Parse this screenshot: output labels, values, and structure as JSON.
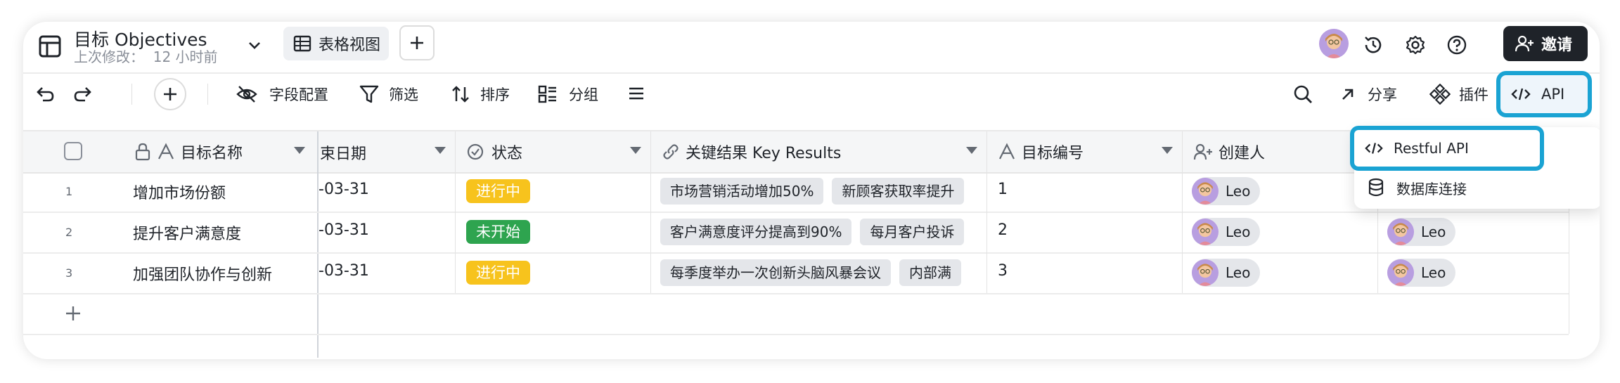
{
  "header": {
    "title": "目标 Objectives",
    "subtitle": "上次修改：  12 小时前",
    "view_label": "表格视图",
    "invite_label": "邀请"
  },
  "toolbar": {
    "field_config": "字段配置",
    "filter": "筛选",
    "sort": "排序",
    "group": "分组",
    "share": "分享",
    "plugins": "插件",
    "api": "API"
  },
  "api_menu": {
    "items": [
      {
        "label": "Restful API"
      },
      {
        "label": "数据库连接"
      }
    ]
  },
  "table": {
    "columns": {
      "name": "目标名称",
      "end_date": "束日期",
      "status": "状态",
      "key_results": "关键结果 Key Results",
      "number": "目标编号",
      "creator": "创建人"
    },
    "rows": [
      {
        "index": "1",
        "name": "增加市场份额",
        "date": "-03-31",
        "status": "进行中",
        "status_color": "#f7c31d",
        "kr1": "市场营销活动增加50%",
        "kr2": "新顾客获取率提升",
        "number": "1",
        "creator": "Leo"
      },
      {
        "index": "2",
        "name": "提升客户满意度",
        "date": "-03-31",
        "status": "未开始",
        "status_color": "#2ea44f",
        "kr1": "客户满意度评分提高到90%",
        "kr2": "每月客户投诉",
        "number": "2",
        "creator": "Leo",
        "extra": "Leo"
      },
      {
        "index": "3",
        "name": "加强团队协作与创新",
        "date": "-03-31",
        "status": "进行中",
        "status_color": "#f7c31d",
        "kr1": "每季度举办一次创新头脑风暴会议",
        "kr2": "内部满",
        "number": "3",
        "creator": "Leo",
        "extra": "Leo"
      }
    ]
  },
  "colors": {
    "highlight": "#1aa3d3",
    "invite_bg": "#1f2329"
  }
}
